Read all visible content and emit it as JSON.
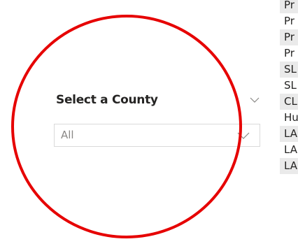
{
  "slicer": {
    "title": "Select a County",
    "selected_value": "All"
  },
  "icons": {
    "header_chevron": "chevron-down-icon",
    "dropdown_chevron": "chevron-down-icon"
  },
  "table": {
    "rows": [
      "Pr",
      "Pr",
      "Pr",
      "Pr",
      "SL",
      "SL",
      "CL",
      "Hu",
      "LA",
      "LA",
      "LA"
    ]
  },
  "annotation": {
    "color": "#e60000"
  }
}
